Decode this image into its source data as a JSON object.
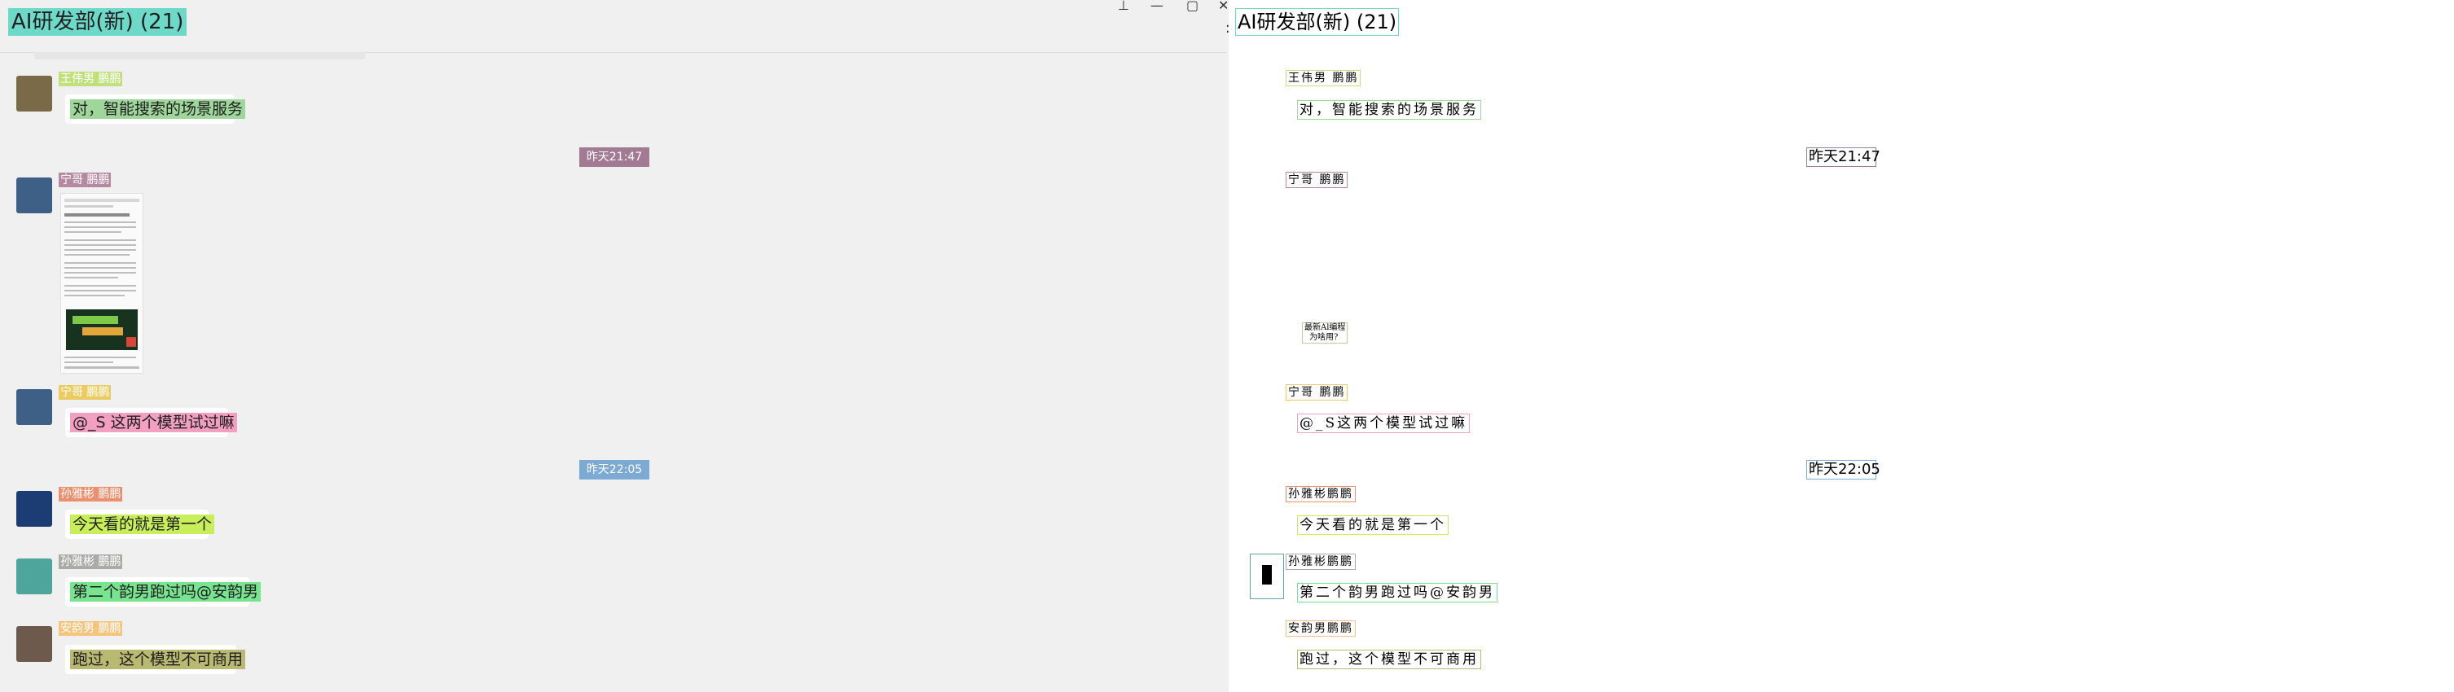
{
  "window": {
    "title": "AI研发部(新) (21)",
    "controls": {
      "pin": "⊥",
      "minimize": "—",
      "maximize": "▢",
      "close": "✕"
    }
  },
  "messages": [
    {
      "name": "王伟男 鹏鹏",
      "name_color": "#bfe07a",
      "text": "对，智能搜索的场景服务",
      "text_color": "#9fd69b",
      "avatar_color": "#7a6a48"
    },
    {
      "time": "昨天21:47",
      "time_color": "#a27a93"
    },
    {
      "name": "宁哥 鹏鹏",
      "name_color": "#b58aa1",
      "avatar_color": "#3e5f86",
      "attachment": {
        "caption_line1": "最新Al编程",
        "caption_line2": "为啥用?"
      }
    },
    {
      "name": "宁哥 鹏鹏",
      "name_color": "#eccb63",
      "text": "@_S 这两个模型试过嘛",
      "text_color": "#f39fc1",
      "avatar_color": "#3e5f86"
    },
    {
      "time": "昨天22:05",
      "time_color": "#7daad5"
    },
    {
      "name": "孙雅彬 鹏鹏",
      "name_color": "#ec8f6f",
      "text": "今天看的就是第一个",
      "text_color": "#c8ee5a",
      "avatar_color": "#1b3d74"
    },
    {
      "name": "孙雅彬 鹏鹏",
      "name_color": "#ababa7",
      "text": "第二个韵男跑过吗@安韵男",
      "text_color": "#78e48f",
      "avatar_color": "#4ea59b"
    },
    {
      "name": "安韵男 鹏鹏",
      "name_color": "#f5c57f",
      "text": "跑过，这个模型不可商用",
      "text_color": "#b9b972",
      "avatar_color": "#6d5a4c"
    }
  ],
  "overlay": {
    "title": "AI研发部(新) (21)",
    "names": [
      "王伟男 鹏鹏",
      "宁哥 鹏鹏",
      "宁哥 鹏鹏",
      "孙雅彬鹏鹏",
      "孙雅彬鹏鹏",
      "安韵男鹏鹏"
    ],
    "messages": [
      "对，智能搜索的场景服务",
      "@_S这两个模型试过嘛",
      "今天看的就是第一个",
      "第二个韵男跑过吗@安韵男",
      "跑过，这个模型不可商用"
    ],
    "times": [
      "昨天21:47",
      "昨天22:05"
    ],
    "mini_caption": [
      "最新Al编程",
      "为啥用?"
    ],
    "dots": "•:"
  }
}
